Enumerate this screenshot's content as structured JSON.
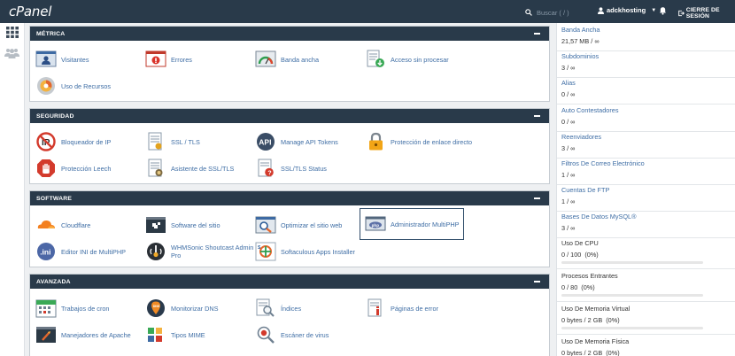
{
  "header": {
    "logo": "cPanel",
    "search_placeholder": "Buscar ( / )",
    "username": "adckhosting",
    "logout_label": "CIERRE DE SESIÓN"
  },
  "sections": [
    {
      "title": "MÉTRICA",
      "items": [
        "Visitantes",
        "Errores",
        "Banda ancha",
        "Acceso sin procesar",
        "Uso de Recursos"
      ]
    },
    {
      "title": "SEGURIDAD",
      "items": [
        "Bloqueador de IP",
        "SSL / TLS",
        "Manage API Tokens",
        "Protección de enlace directo",
        "Protección Leech",
        "Asistente de SSL/TLS",
        "SSL/TLS Status"
      ]
    },
    {
      "title": "SOFTWARE",
      "items": [
        "Cloudflare",
        "Software del sitio",
        "Optimizar el sitio web",
        "Administrador MultiPHP",
        "Editor INI de MultiPHP",
        "WHMSonic Shoutcast Admin Pro",
        "Softaculous Apps Installer"
      ]
    },
    {
      "title": "AVANZADA",
      "items": [
        "Trabajos de cron",
        "Monitorizar DNS",
        "Índices",
        "Páginas de error",
        "Manejadores de Apache",
        "Tipos MIME",
        "Escáner de virus"
      ]
    }
  ],
  "stats": [
    {
      "label": "Banda Ancha",
      "value": "21,57 MB / ∞"
    },
    {
      "label": "Subdominios",
      "value": "3 / ∞"
    },
    {
      "label": "Alias",
      "value": "0 / ∞"
    },
    {
      "label": "Auto Contestadores",
      "value": "0 / ∞"
    },
    {
      "label": "Reenviadores",
      "value": "3 / ∞"
    },
    {
      "label": "Filtros De Correo Electrónico",
      "value": "1 / ∞"
    },
    {
      "label": "Cuentas De FTP",
      "value": "1 / ∞"
    },
    {
      "label": "Bases De Datos MySQL®",
      "value": "3 / ∞"
    },
    {
      "label": "Uso De CPU",
      "value": "0 / 100",
      "percent": "(0%)",
      "fraction": 0
    },
    {
      "label": "Procesos Entrantes",
      "value": "0 / 80",
      "percent": "(0%)",
      "fraction": 0
    },
    {
      "label": "Uso De Memoria Virtual",
      "value": "0 bytes / 2 GB",
      "percent": "(0%)",
      "fraction": 0
    },
    {
      "label": "Uso De Memoria Física",
      "value": "0 bytes / 2 GB",
      "percent": "(0%)",
      "fraction": 0
    }
  ],
  "colors": {
    "topbar": "#293a4a",
    "panel_header": "#293a4a",
    "link": "#3f6ea5"
  }
}
